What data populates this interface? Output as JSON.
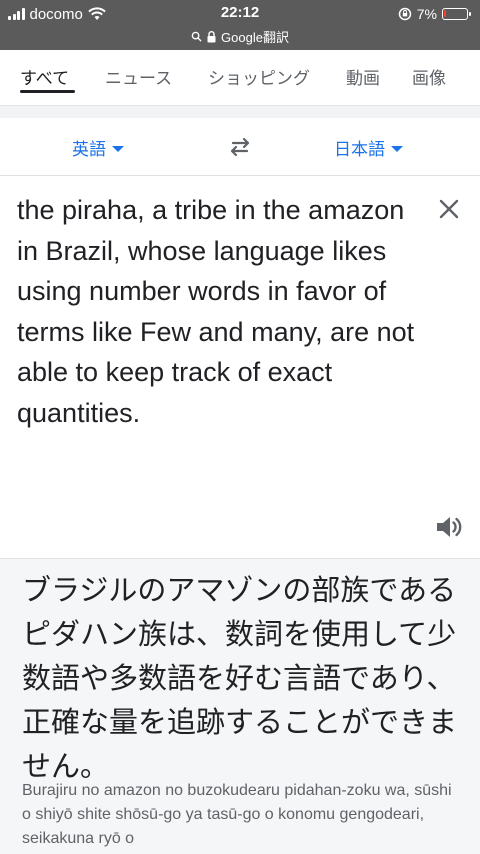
{
  "status_bar": {
    "carrier": "docomo",
    "time": "22:12",
    "battery_percent": "7%",
    "battery_level": 0.07,
    "url": "Google翻訳"
  },
  "tabs": [
    {
      "label": "すべて",
      "active": true
    },
    {
      "label": "ニュース",
      "active": false
    },
    {
      "label": "ショッピング",
      "active": false
    },
    {
      "label": "動画",
      "active": false
    },
    {
      "label": "画像",
      "active": false
    }
  ],
  "languages": {
    "source": "英語",
    "target": "日本語"
  },
  "source_text": "the piraha, a tribe in the amazon in Brazil, whose language likes using number words in favor of terms like Few and many, are not able to keep track of exact quantities.",
  "translation": {
    "text": "ブラジルのアマゾンの部族であるピダハン族は、数詞を使用して少数語や多数語を好む言語であり、正確な量を追跡することができません。",
    "romanization": "Burajiru no amazon no buzokudearu pidahan-zoku wa, sūshi o shiyō shite shōsū-go ya tasū-go o konomu gengodeari, seikakuna ryō o"
  },
  "colors": {
    "status_bar": "#5b5b5b",
    "accent": "#1a73e8",
    "result_bg": "#f5f6f7",
    "battery_low": "#ff3b30"
  },
  "icons": [
    "wifi-icon",
    "signal-icon",
    "orientation-lock-icon",
    "battery-icon",
    "search-icon",
    "lock-icon",
    "swap-icon",
    "close-icon",
    "speaker-icon",
    "caret-down-icon"
  ]
}
